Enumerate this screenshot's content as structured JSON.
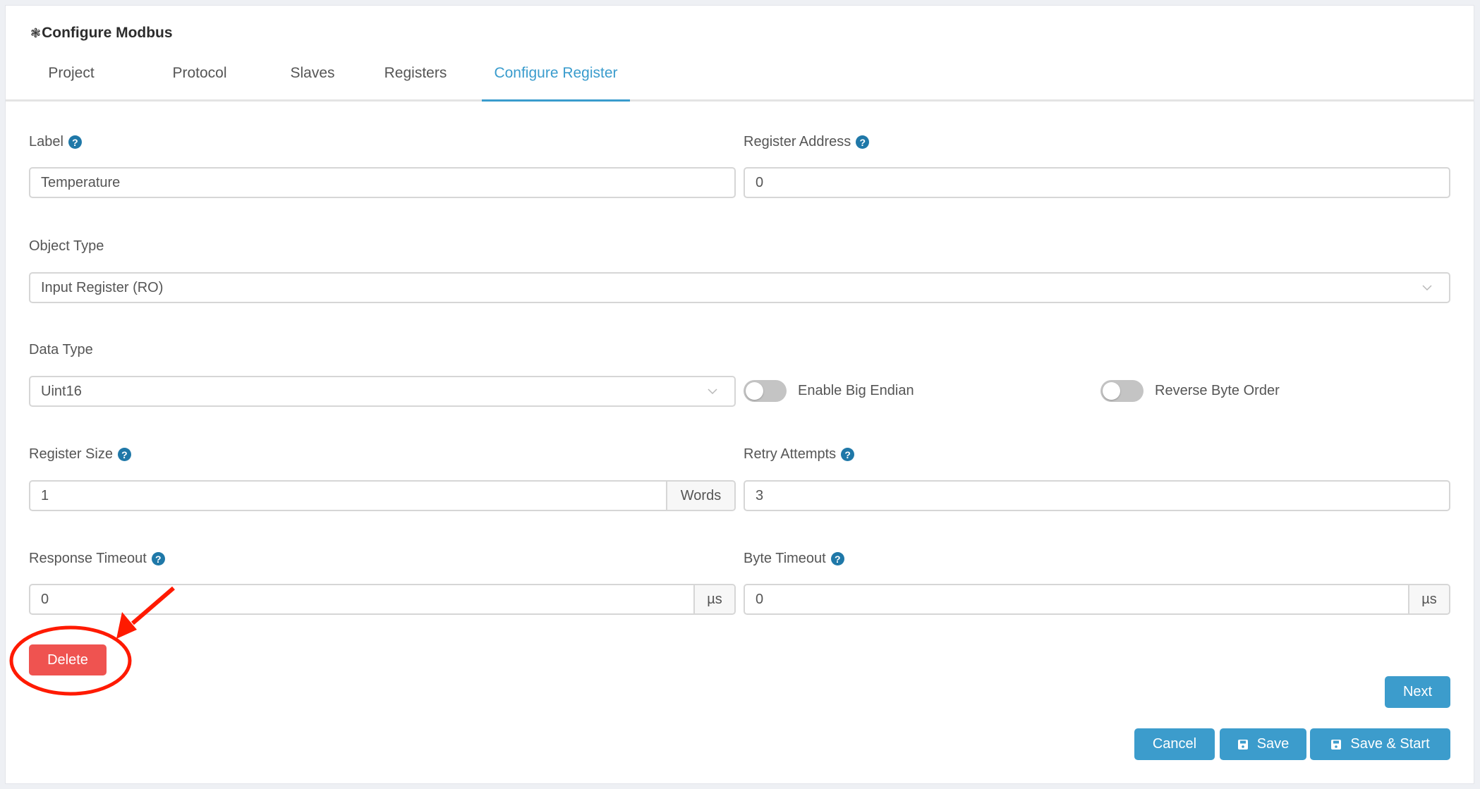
{
  "header": {
    "icon": "cog-icon",
    "title": "Configure Modbus"
  },
  "tabs": [
    {
      "label": "Project",
      "active": false
    },
    {
      "label": "Protocol",
      "active": false
    },
    {
      "label": "Slaves",
      "active": false
    },
    {
      "label": "Registers",
      "active": false
    },
    {
      "label": "Configure Register",
      "active": true
    }
  ],
  "form": {
    "label": {
      "label": "Label",
      "value": "Temperature"
    },
    "register_address": {
      "label": "Register Address",
      "value": "0"
    },
    "object_type": {
      "label": "Object Type",
      "selected": "Input Register (RO)"
    },
    "data_type": {
      "label": "Data Type",
      "selected": "Uint16"
    },
    "enable_big_endian": {
      "label": "Enable Big Endian",
      "on": false
    },
    "reverse_byte_order": {
      "label": "Reverse Byte Order",
      "on": false
    },
    "register_size": {
      "label": "Register Size",
      "value": "1",
      "unit": "Words"
    },
    "retry_attempts": {
      "label": "Retry Attempts",
      "value": "3"
    },
    "response_timeout": {
      "label": "Response Timeout",
      "value": "0",
      "unit": "µs"
    },
    "byte_timeout": {
      "label": "Byte Timeout",
      "value": "0",
      "unit": "µs"
    }
  },
  "help_glyph": "?",
  "buttons": {
    "delete": "Delete",
    "next": "Next",
    "cancel": "Cancel",
    "save": "Save",
    "save_start": "Save & Start"
  },
  "colors": {
    "accent": "#3c9ccc",
    "danger": "#ef5350",
    "annotation": "#ff1a00",
    "help": "#1f78a8"
  }
}
